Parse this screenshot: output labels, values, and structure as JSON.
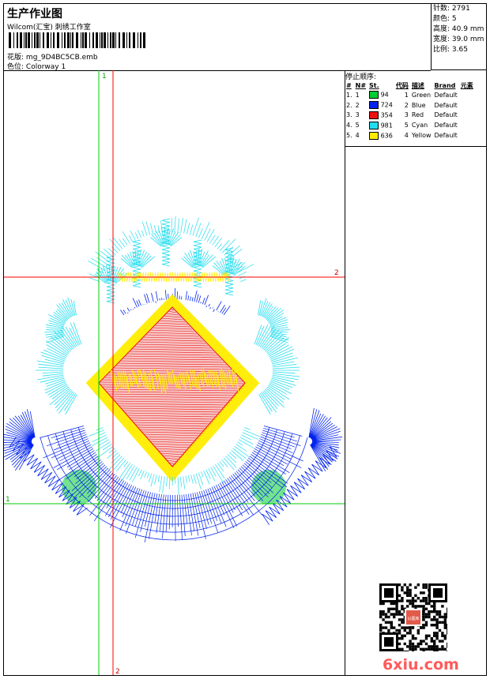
{
  "header": {
    "title": "生产作业图",
    "subtitle": "Wilcom(汇宝) 刺绣工作室",
    "pattern_label": "花版:",
    "pattern_value": "mg_9D4BC5CB.emb",
    "colorway_label": "色位:",
    "colorway_value": "Colorway 1"
  },
  "stats": [
    {
      "label": "针数:",
      "value": "2791"
    },
    {
      "label": "颜色:",
      "value": "5"
    },
    {
      "label": "高度:",
      "value": "40.9 mm"
    },
    {
      "label": "宽度:",
      "value": "39.0 mm"
    },
    {
      "label": "比例:",
      "value": "3.65"
    }
  ],
  "stop_sequence": {
    "title": "停止顺序:",
    "headers": [
      "#",
      "N#",
      "St.",
      "代码",
      "描述",
      "Brand",
      "元素"
    ],
    "rows": [
      {
        "num": "1.",
        "n": "1",
        "color": "#00cc33",
        "st": "94",
        "code": "1",
        "desc": "Green",
        "brand": "Default"
      },
      {
        "num": "2.",
        "n": "2",
        "color": "#0022ee",
        "st": "724",
        "code": "2",
        "desc": "Blue",
        "brand": "Default"
      },
      {
        "num": "3.",
        "n": "3",
        "color": "#ee1111",
        "st": "354",
        "code": "3",
        "desc": "Red",
        "brand": "Default"
      },
      {
        "num": "4.",
        "n": "5",
        "color": "#22ddee",
        "st": "981",
        "code": "5",
        "desc": "Cyan",
        "brand": "Default"
      },
      {
        "num": "5.",
        "n": "4",
        "color": "#ffee00",
        "st": "636",
        "code": "4",
        "desc": "Yellow",
        "brand": "Default"
      }
    ]
  },
  "guides": {
    "h1": "1",
    "v1": "1",
    "h2": "2",
    "v2": "2"
  },
  "colors": {
    "green": "#00cc33",
    "blue": "#0022ee",
    "red": "#ee1111",
    "cyan": "#22ddee",
    "yellow": "#ffee00"
  },
  "watermark": {
    "qr_stamp": "以图库",
    "logo": "6xiu.com"
  }
}
